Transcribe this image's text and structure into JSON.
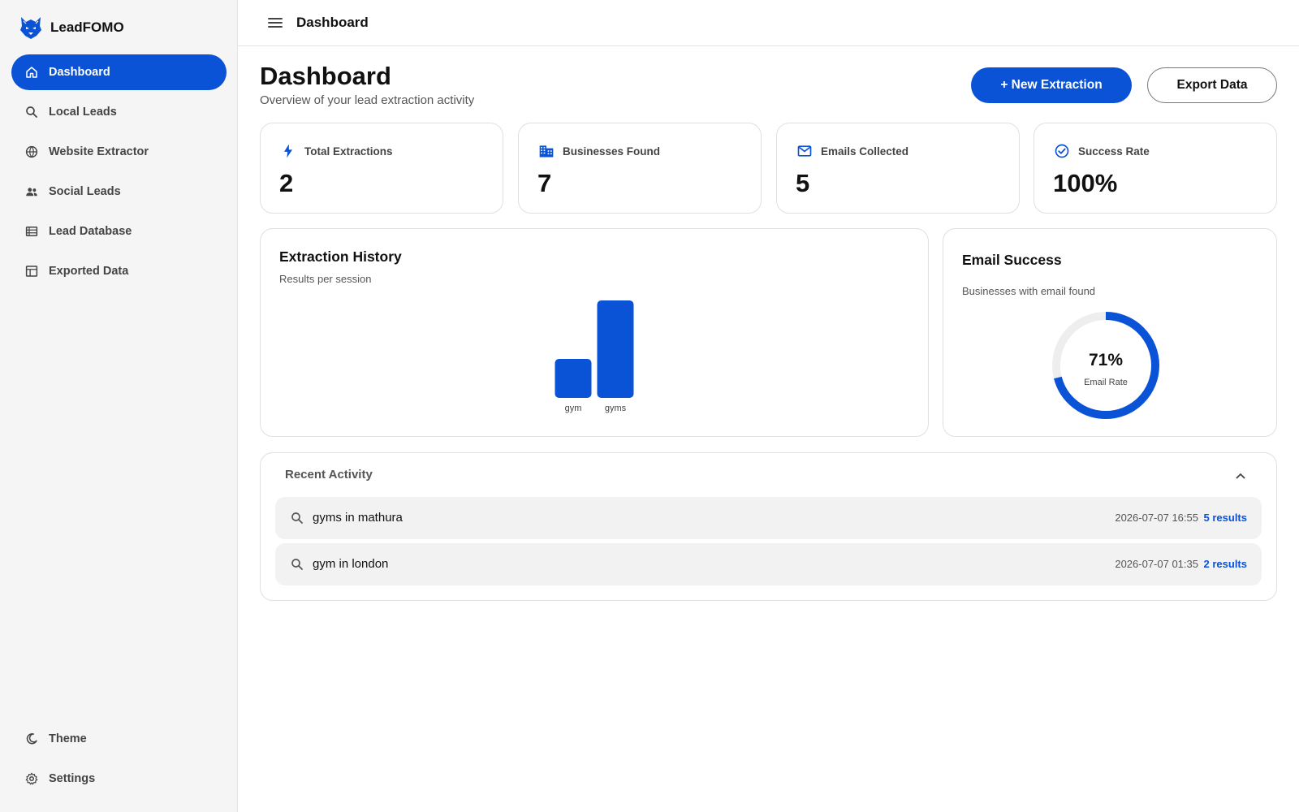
{
  "app": {
    "name": "LeadFOMO"
  },
  "sidebar": {
    "items": [
      {
        "label": "Dashboard",
        "icon": "home-icon",
        "active": true
      },
      {
        "label": "Local Leads",
        "icon": "search-icon"
      },
      {
        "label": "Website Extractor",
        "icon": "globe-icon"
      },
      {
        "label": "Social Leads",
        "icon": "people-icon"
      },
      {
        "label": "Lead Database",
        "icon": "list-icon"
      },
      {
        "label": "Exported Data",
        "icon": "table-icon"
      }
    ],
    "bottom": [
      {
        "label": "Theme",
        "icon": "moon-icon"
      },
      {
        "label": "Settings",
        "icon": "gear-icon"
      }
    ]
  },
  "topbar": {
    "title": "Dashboard"
  },
  "header": {
    "title": "Dashboard",
    "subtitle": "Overview of your lead extraction activity",
    "new_extraction_label": "+ New Extraction",
    "export_label": "Export Data"
  },
  "stats": [
    {
      "label": "Total Extractions",
      "value": "2",
      "icon": "bolt-icon"
    },
    {
      "label": "Businesses Found",
      "value": "7",
      "icon": "building-icon"
    },
    {
      "label": "Emails Collected",
      "value": "5",
      "icon": "mail-icon"
    },
    {
      "label": "Success Rate",
      "value": "100%",
      "icon": "check-circle-icon"
    }
  ],
  "extraction_history": {
    "title": "Extraction History",
    "subtitle": "Results per session"
  },
  "email_success": {
    "title": "Email Success",
    "subtitle": "Businesses with email found",
    "percent_label": "71%",
    "caption": "Email Rate",
    "fraction": 0.71
  },
  "chart_data": {
    "type": "bar",
    "categories": [
      "gym",
      "gyms"
    ],
    "values": [
      2,
      5
    ],
    "title": "Extraction History",
    "xlabel": "",
    "ylabel": "",
    "ylim": [
      0,
      5
    ],
    "grid": false,
    "color": "#0a52d6"
  },
  "recent_activity": {
    "title": "Recent Activity",
    "items": [
      {
        "query": "gyms in mathura",
        "time": "2026-07-07 16:55",
        "results": "5 results"
      },
      {
        "query": "gym in london",
        "time": "2026-07-07 01:35",
        "results": "2 results"
      }
    ]
  },
  "colors": {
    "accent": "#0a52d6",
    "sidebar_bg": "#f5f5f5",
    "track": "#eeeeee"
  }
}
